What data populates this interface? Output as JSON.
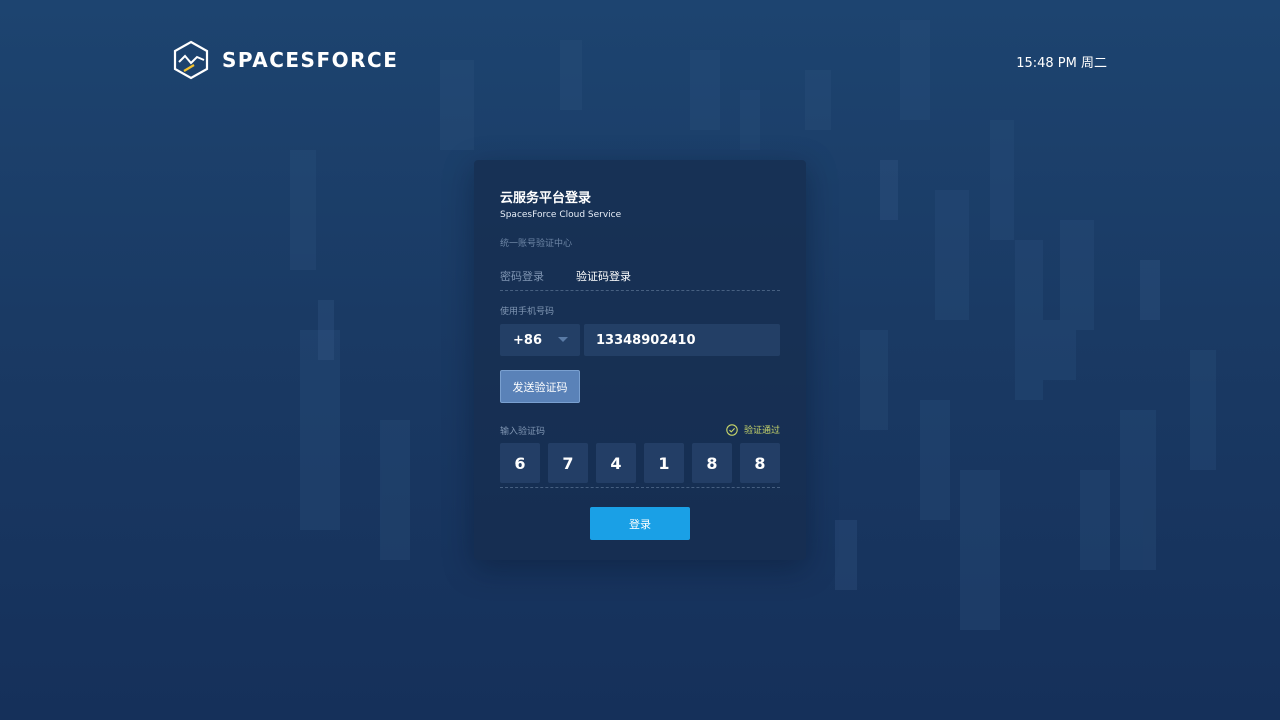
{
  "header": {
    "brand_name": "SPACESFORCE",
    "logo_icon": "hexagon-chart-logo",
    "clock_text": "15:48 PM 周二"
  },
  "login_card": {
    "title": "云服务平台登录",
    "subtitle": "SpacesForce Cloud Service",
    "hint": "统一账号验证中心",
    "tabs": [
      {
        "label": "密码登录",
        "active": false
      },
      {
        "label": "验证码登录",
        "active": true
      }
    ],
    "phone": {
      "label": "使用手机号码",
      "country_code": "+86",
      "number": "13348902410"
    },
    "send_code_button": "发送验证码",
    "code": {
      "label": "输入验证码",
      "status_text": "验证通过",
      "status_icon": "check-circle-icon",
      "digits": [
        "6",
        "7",
        "4",
        "1",
        "8",
        "8"
      ]
    },
    "login_button": "登录"
  },
  "colors": {
    "background": "#1b3d68",
    "accent": "#1aa0e6",
    "secondary_button": "#5a82b8",
    "success": "#c8d66a"
  }
}
